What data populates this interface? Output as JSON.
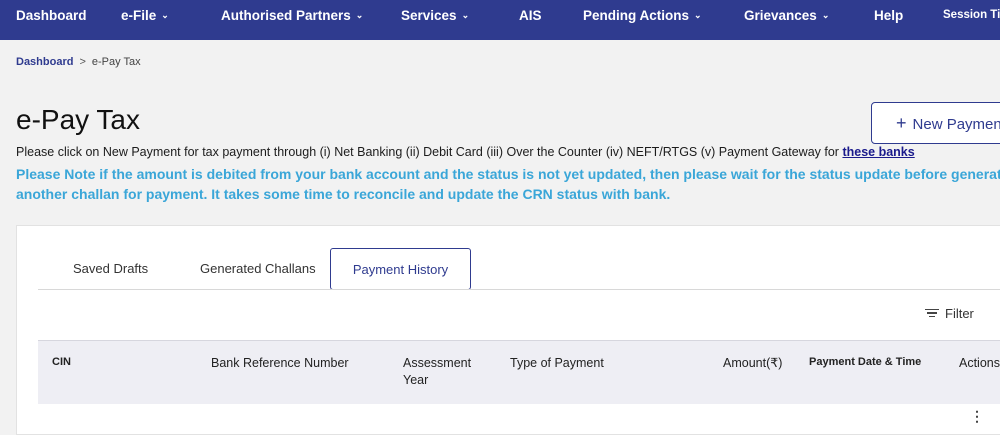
{
  "nav": {
    "dashboard": "Dashboard",
    "efile": "e-File",
    "authorised_partners": "Authorised Partners",
    "services": "Services",
    "ais": "AIS",
    "pending_actions": "Pending Actions",
    "grievances": "Grievances",
    "help": "Help",
    "session": "Session Tim"
  },
  "breadcrumb": {
    "home": "Dashboard",
    "separator": ">",
    "current": "e-Pay Tax"
  },
  "page": {
    "title": "e-Pay Tax",
    "new_payment": "New Payment",
    "info_text": "Please click on New Payment for tax payment through (i) Net Banking (ii) Debit Card (iii) Over the Counter (iv) NEFT/RTGS (v) Payment Gateway for",
    "info_link": "these banks",
    "note_line1": "Please Note if the amount is debited from your bank account and the status is not yet updated, then please wait for the status update before generating",
    "note_line2": "another challan for payment. It takes some time to reconcile and update the CRN status with bank."
  },
  "tabs": {
    "saved_drafts": "Saved Drafts",
    "generated_challans": "Generated Challans",
    "payment_history": "Payment History"
  },
  "filter": {
    "label": "Filter"
  },
  "table": {
    "headers": {
      "cin": "CIN",
      "bank_ref": "Bank Reference Number",
      "assessment_year_1": "Assessment",
      "assessment_year_2": "Year",
      "type_of_payment": "Type of Payment",
      "amount": "Amount(₹)",
      "payment_date_time": "Payment Date & Time",
      "actions": "Actions"
    }
  },
  "colors": {
    "nav": "#2f3b8f",
    "accent": "#2f3b8f",
    "note": "#3aa6d8"
  },
  "icons": [
    "chevron-down-icon",
    "plus-icon",
    "filter-icon",
    "more-vertical-icon"
  ]
}
